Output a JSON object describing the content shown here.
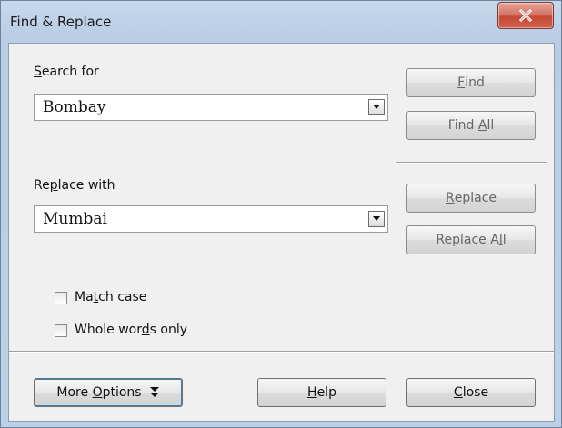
{
  "window": {
    "title": "Find & Replace"
  },
  "search": {
    "label_pre": "",
    "label_u": "S",
    "label_post": "earch for",
    "value": "Bombay"
  },
  "replace": {
    "label_pre": "Re",
    "label_u": "p",
    "label_post": "lace with",
    "value": "Mumbai"
  },
  "buttons": {
    "find": {
      "pre": "",
      "u": "F",
      "post": "ind"
    },
    "find_all": {
      "pre": "Find ",
      "u": "A",
      "post": "ll"
    },
    "replace": {
      "pre": "",
      "u": "R",
      "post": "eplace"
    },
    "replace_all": {
      "pre": "Replace A",
      "u": "l",
      "post": "l"
    },
    "more_options": {
      "pre": "More ",
      "u": "O",
      "post": "ptions"
    },
    "help": {
      "pre": "",
      "u": "H",
      "post": "elp"
    },
    "close": {
      "pre": "",
      "u": "C",
      "post": "lose"
    }
  },
  "options": {
    "match_case": {
      "pre": "Ma",
      "u": "t",
      "post": "ch case",
      "checked": false
    },
    "whole_words": {
      "pre": "Whole wor",
      "u": "d",
      "post": "s only",
      "checked": false
    }
  }
}
